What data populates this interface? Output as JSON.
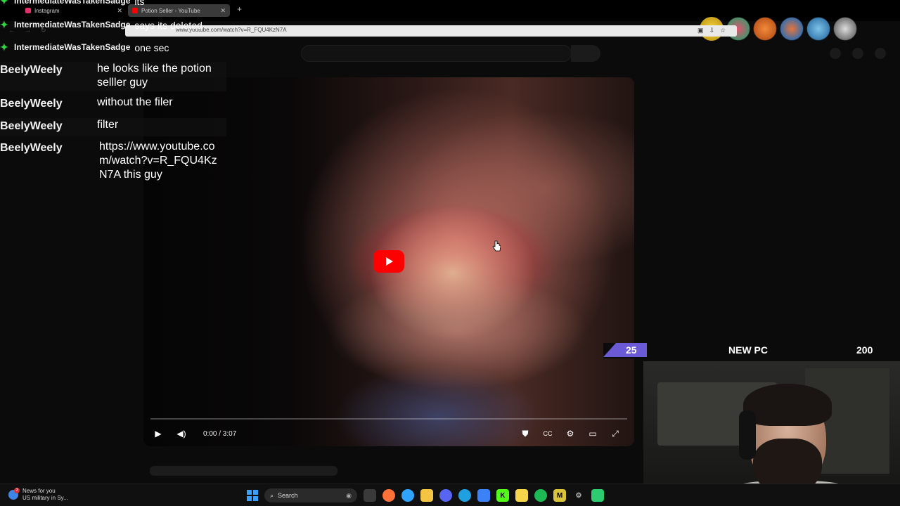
{
  "browser": {
    "tabs": [
      {
        "label": "Instagram",
        "active": false,
        "favicon_color": "#e1306c"
      },
      {
        "label": "Potion Seller - YouTube",
        "active": true,
        "favicon_color": "#ff0000"
      }
    ],
    "url": "www.youtube.com/watch?v=R_FQU4KzN7A"
  },
  "chat_top": [
    {
      "user": "IntermediateWasTakenSadge",
      "message": "its",
      "partial": true
    },
    {
      "user": "IntermediateWasTakenSadge",
      "message": "says its deleted"
    },
    {
      "user": "IntermediateWasTakenSadge",
      "message": "one sec"
    }
  ],
  "chat": [
    {
      "user": "BeelyWeely",
      "message": "he looks like the potion selller guy"
    },
    {
      "user": "BeelyWeely",
      "message": "without the filer"
    },
    {
      "user": "BeelyWeely",
      "message": "filter"
    },
    {
      "user": "BeelyWeely",
      "message": "https://www.youtube.com/watch?v=R_FQU4KzN7A this guy"
    }
  ],
  "video": {
    "time": "0:00 / 3:07",
    "progress": 0.0,
    "accent": "#ff0000"
  },
  "goal": {
    "current": "25",
    "title": "NEW PC",
    "target": "200",
    "fill_color": "#6b5ad6"
  },
  "taskbar": {
    "news_title": "News for you",
    "news_sub": "US military in Sy...",
    "news_badge": "2",
    "search_placeholder": "Search",
    "apps": [
      {
        "name": "task-view",
        "color": "#555"
      },
      {
        "name": "firefox",
        "color": "#ff7139"
      },
      {
        "name": "copilot",
        "color": "#2fa4ff"
      },
      {
        "name": "file-explorer",
        "color": "#f4c542"
      },
      {
        "name": "discord",
        "color": "#5865f2"
      },
      {
        "name": "edge",
        "color": "#1fa0e0"
      },
      {
        "name": "store",
        "color": "#3b82f6"
      },
      {
        "name": "kick",
        "color": "#53fc18"
      },
      {
        "name": "sticky-notes",
        "color": "#f7d64a"
      },
      {
        "name": "spotify",
        "color": "#1db954"
      },
      {
        "name": "app-m",
        "color": "#d8c33a"
      },
      {
        "name": "settings-gear",
        "color": "#aaa"
      },
      {
        "name": "app-green",
        "color": "#2ecc71"
      }
    ]
  }
}
